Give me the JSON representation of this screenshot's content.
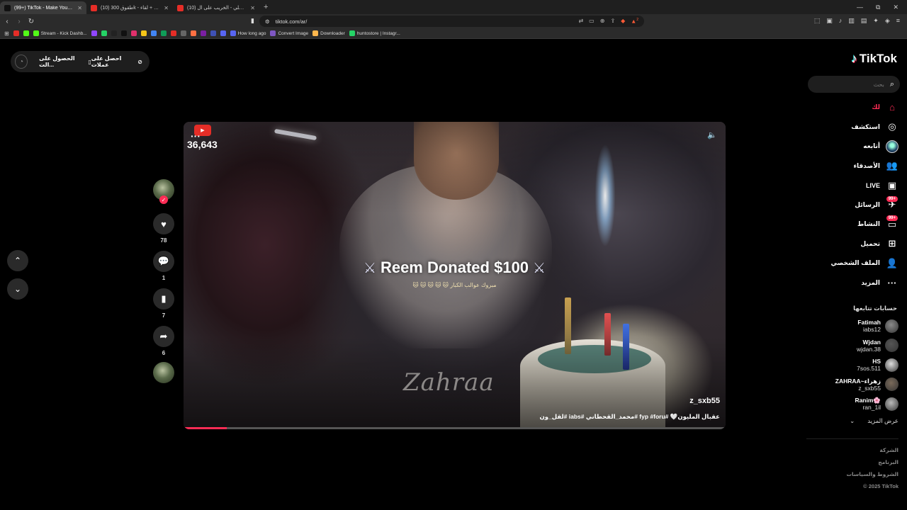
{
  "browser": {
    "tabs": [
      {
        "title": "(99+) TikTok - Make Your Day",
        "favicon_color": "#111111",
        "active": true
      },
      {
        "title": "(10) طقوق 300k - ابوي بشكركم + لقاء ..",
        "favicon_color": "#e52d27",
        "active": false
      },
      {
        "title": "(10) لو جزوواك مع علي - الخريب على ال..",
        "favicon_color": "#e52d27",
        "active": false
      }
    ],
    "new_tab": "+",
    "url": "tiktok.com/ar/",
    "notification_count": "2",
    "bookmarks": [
      {
        "label": "",
        "color": "#e52d27"
      },
      {
        "label": "",
        "color": "#53fc18"
      },
      {
        "label": "Stream - Kick Dashb...",
        "color": "#53fc18"
      },
      {
        "label": "",
        "color": "#9146ff"
      },
      {
        "label": "",
        "color": "#25d366"
      },
      {
        "label": "",
        "color": "#222222"
      },
      {
        "label": "",
        "color": "#111111"
      },
      {
        "label": "",
        "color": "#e1306c"
      },
      {
        "label": "",
        "color": "#f5c518"
      },
      {
        "label": "",
        "color": "#4285f4"
      },
      {
        "label": "",
        "color": "#0f9d58"
      },
      {
        "label": "",
        "color": "#e52d27"
      },
      {
        "label": "",
        "color": "#666666"
      },
      {
        "label": "",
        "color": "#ff7043"
      },
      {
        "label": "",
        "color": "#7b1fa2"
      },
      {
        "label": "",
        "color": "#3f51b5"
      },
      {
        "label": "",
        "color": "#5865f2"
      },
      {
        "label": "How long ago",
        "color": "#5865f2"
      },
      {
        "label": "Convert Image",
        "color": "#7e57c2"
      },
      {
        "label": "Downloader",
        "color": "#ffb74d"
      },
      {
        "label": "huntostore | Instagr...",
        "color": "#25d366"
      }
    ]
  },
  "get_app": {
    "coins_label": "احصل على عملات",
    "app_label": "الحصول على الت..."
  },
  "sidebar": {
    "logo": "TikTok",
    "search_placeholder": "بحث",
    "nav": [
      {
        "label": "لك",
        "icon": "home-icon",
        "glyph": "⌂",
        "key": "home"
      },
      {
        "label": "استكشف",
        "icon": "compass-icon",
        "glyph": "◎",
        "key": "explore"
      },
      {
        "label": "أتابعه",
        "icon": "following-avatar-icon",
        "glyph": "",
        "key": "following"
      },
      {
        "label": "الأصدقاء",
        "icon": "friends-icon",
        "glyph": "👥",
        "key": "friends"
      },
      {
        "label": "LIVE",
        "icon": "live-icon",
        "glyph": "▣",
        "key": "live"
      },
      {
        "label": "الرسائل",
        "icon": "messages-icon",
        "glyph": "✈",
        "key": "messages",
        "badge": "99+"
      },
      {
        "label": "النشاط",
        "icon": "activity-icon",
        "glyph": "▭",
        "key": "activity",
        "badge": "99+"
      },
      {
        "label": "تحميل",
        "icon": "upload-icon",
        "glyph": "⊞",
        "key": "upload"
      },
      {
        "label": "الملف الشخصي",
        "icon": "profile-icon",
        "glyph": "👤",
        "key": "profile"
      },
      {
        "label": "المزيد",
        "icon": "more-icon",
        "glyph": "···",
        "key": "more"
      }
    ],
    "following_title": "حسابات تتابعها",
    "following": [
      {
        "name": "Fatimah",
        "handle": "iabs12"
      },
      {
        "name": "Wjdan",
        "handle": "wjdan.38"
      },
      {
        "name": "HS",
        "handle": "7sos.511"
      },
      {
        "name": "ZAHRAA~زهراء",
        "handle": "z_sxb55"
      },
      {
        "name": "Ranim🌸",
        "handle": "ran_1il"
      }
    ],
    "see_more": "عرض المزيد",
    "footer": [
      "الشركة",
      "البرنامج",
      "الشروط والسياسات",
      "© 2025 TikTok"
    ]
  },
  "video": {
    "viewer_count": "36,643",
    "overlay_title": "Reem Donated $100",
    "overlay_sub": "🐱 🐱 🐱 🐱 🐱 مبروك عوالب الكبار",
    "watermark": "Zahraa",
    "username": "z_sxb55",
    "caption": "عقبال المليون🤍 #fyp #foru #محمد_القحطاني #iabs #لقل_ون",
    "progress_fraction": 0.08
  },
  "actions": {
    "likes": "78",
    "comments": "1",
    "saves": "7",
    "shares": "6"
  },
  "colors": {
    "accent": "#fe2c55",
    "background": "#000000"
  }
}
